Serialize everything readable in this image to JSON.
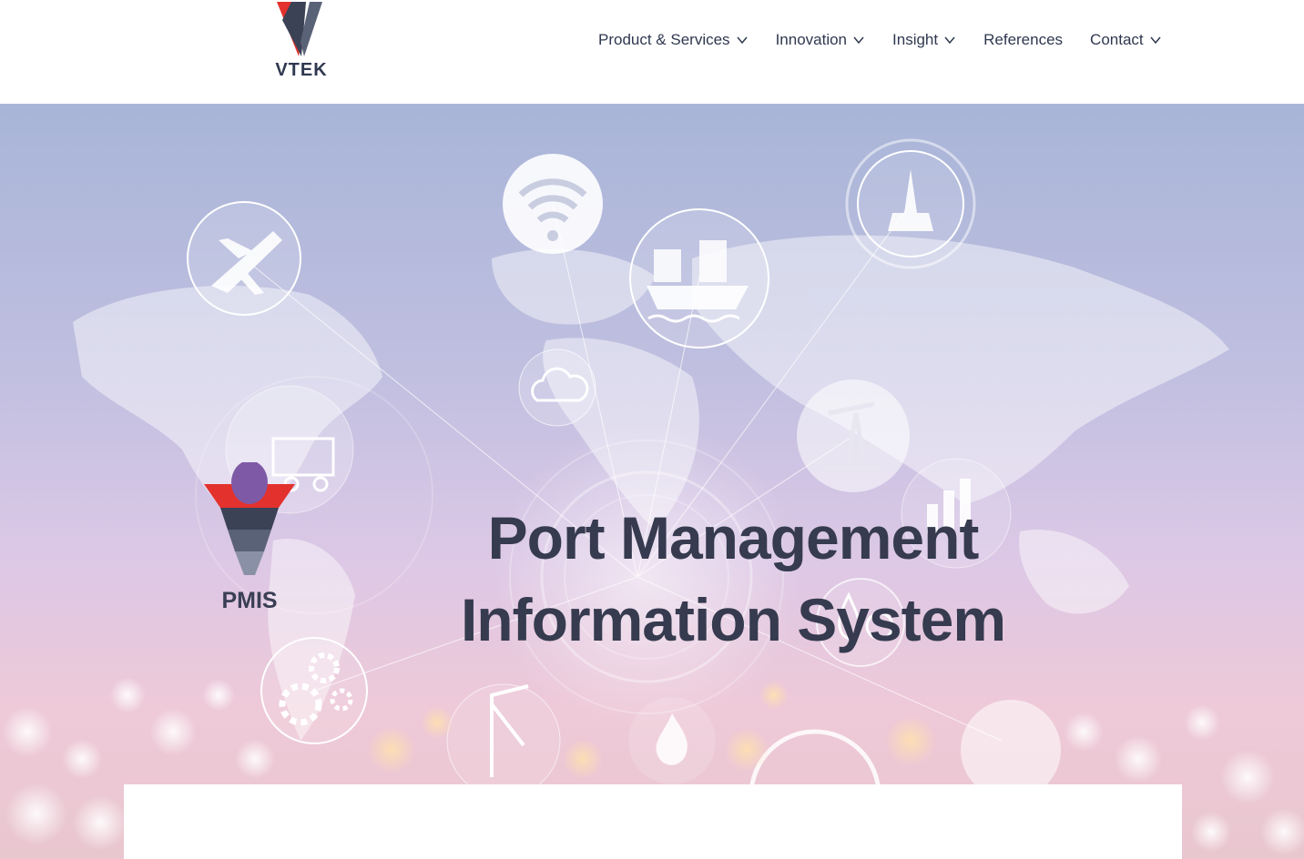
{
  "brand": {
    "logo_text": "VTEK"
  },
  "nav": {
    "items": [
      {
        "label": "Product & Services",
        "has_dropdown": true
      },
      {
        "label": "Innovation",
        "has_dropdown": true
      },
      {
        "label": "Insight",
        "has_dropdown": true
      },
      {
        "label": "References",
        "has_dropdown": false
      },
      {
        "label": "Contact",
        "has_dropdown": true
      }
    ]
  },
  "hero": {
    "badge_text": "PMIS",
    "title": "Port Management Information System",
    "icons": [
      "airplane-icon",
      "wifi-icon",
      "cargo-ship-icon",
      "oil-rig-icon",
      "cloud-icon",
      "truck-icon",
      "oil-pump-icon",
      "bar-chart-icon",
      "gears-icon",
      "crane-icon",
      "oil-drop-dollar-icon",
      "flame-icon"
    ]
  },
  "colors": {
    "brand_red": "#e3312d",
    "brand_dark": "#3b4256",
    "brand_purple": "#7e5aa6",
    "text_dark": "#363b4f"
  }
}
